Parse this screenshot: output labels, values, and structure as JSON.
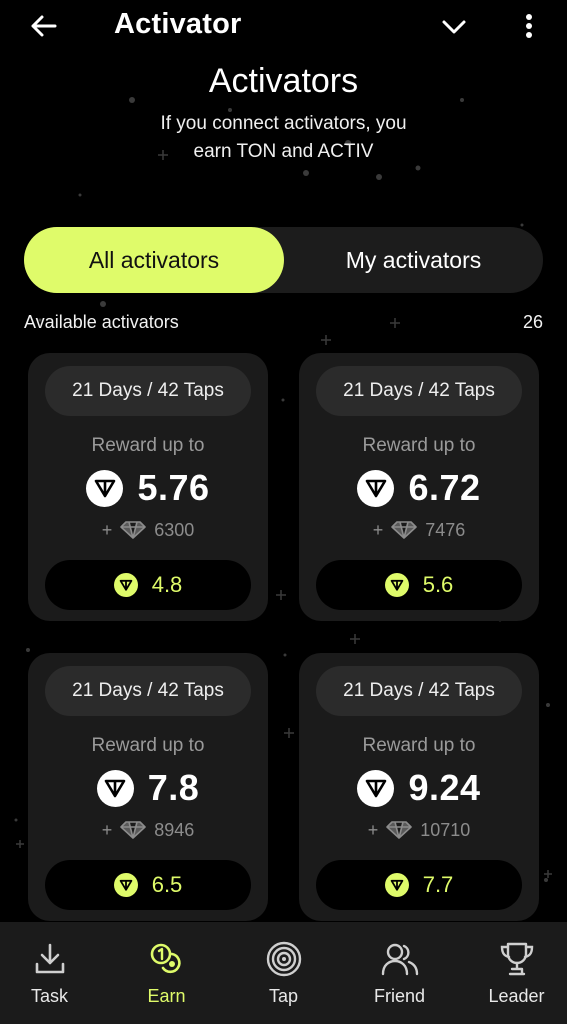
{
  "header": {
    "title": "Activator",
    "back_icon": "arrow-left-icon",
    "dropdown_icon": "chevron-down-icon",
    "menu_icon": "more-vertical-icon"
  },
  "hero": {
    "title": "Activators",
    "subtitle_line1": "If you connect activators, you",
    "subtitle_line2": "earn TON and ACTIV"
  },
  "tabs": [
    {
      "label": "All activators",
      "active": true
    },
    {
      "label": "My activators",
      "active": false
    }
  ],
  "list": {
    "label": "Available activators",
    "count": "26"
  },
  "cards": [
    {
      "duration": "21 Days / 42 Taps",
      "reward_label": "Reward up to",
      "reward": "5.76",
      "gems": "6300",
      "price": "4.8"
    },
    {
      "duration": "21 Days / 42 Taps",
      "reward_label": "Reward up to",
      "reward": "6.72",
      "gems": "7476",
      "price": "5.6"
    },
    {
      "duration": "21 Days / 42 Taps",
      "reward_label": "Reward up to",
      "reward": "7.8",
      "gems": "8946",
      "price": "6.5"
    },
    {
      "duration": "21 Days / 42 Taps",
      "reward_label": "Reward up to",
      "reward": "9.24",
      "gems": "10710",
      "price": "7.7"
    }
  ],
  "gem_prefix": "+",
  "nav": [
    {
      "label": "Task",
      "icon": "download-icon",
      "active": false
    },
    {
      "label": "Earn",
      "icon": "coins-icon",
      "active": true
    },
    {
      "label": "Tap",
      "icon": "target-icon",
      "active": false
    },
    {
      "label": "Friend",
      "icon": "users-icon",
      "active": false
    },
    {
      "label": "Leader",
      "icon": "trophy-icon",
      "active": false
    }
  ],
  "colors": {
    "accent": "#dffb6a",
    "background": "#000000",
    "card": "#1b1b1b",
    "pill": "#2b2b2b"
  }
}
